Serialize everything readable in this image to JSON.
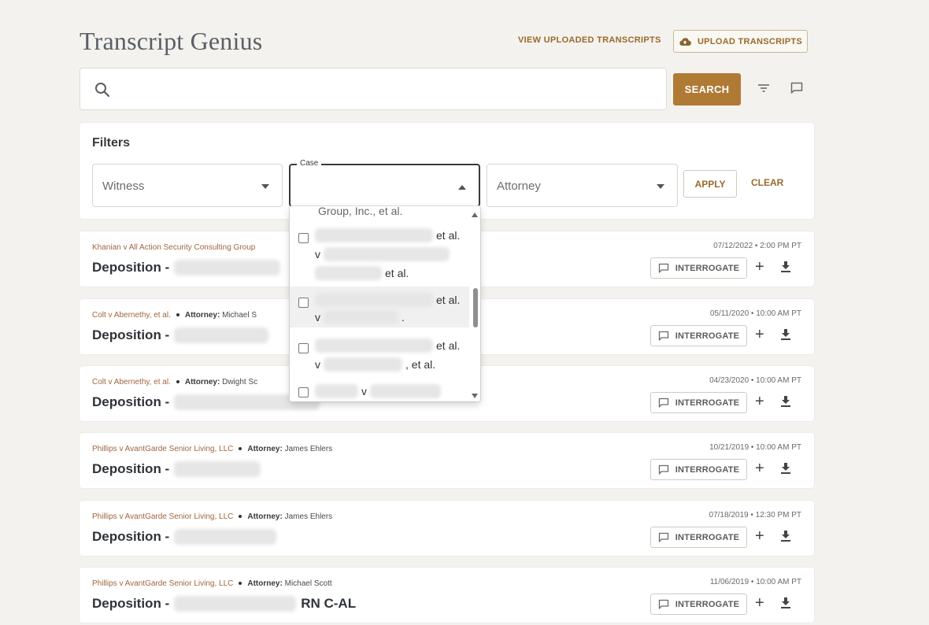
{
  "app": {
    "title": "Transcript Genius",
    "view_uploaded": "VIEW UPLOADED TRANSCRIPTS",
    "upload": "UPLOAD TRANSCRIPTS"
  },
  "search": {
    "value": "",
    "button": "SEARCH"
  },
  "filters": {
    "title": "Filters",
    "witness_placeholder": "Witness",
    "case_label": "Case",
    "attorney_placeholder": "Attorney",
    "apply": "APPLY",
    "clear": "CLEAR"
  },
  "dropdown": {
    "partial_top": "Group, Inc., et al.",
    "options": [
      {
        "l1_suffix": "et al.",
        "l2_prefix": "v",
        "l3_suffix": "et al."
      },
      {
        "l1_suffix": "et al.",
        "l2_prefix": "v",
        "l2_suffix": "."
      },
      {
        "l1_suffix": "et al.",
        "l2_prefix": "v",
        "l2_suffix": ", et al."
      },
      {
        "l1_mid": "v"
      }
    ]
  },
  "cards": [
    {
      "case": "Khanian v All Action Security Consulting Group",
      "attorney_label": "",
      "attorney": "",
      "title": "Deposition -",
      "title_suffix": "",
      "date": "07/12/2022 • 2:00 PM PT"
    },
    {
      "case": "Colt v Abernethy, et al.",
      "attorney_label": "Attorney:",
      "attorney": "Michael S",
      "title": "Deposition -",
      "title_suffix": "",
      "date": "05/11/2020 • 10:00 AM PT"
    },
    {
      "case": "Colt v Abernethy, et al.",
      "attorney_label": "Attorney:",
      "attorney": "Dwight Sc",
      "title": "Deposition -",
      "title_suffix": "",
      "date": "04/23/2020 • 10:00 AM PT"
    },
    {
      "case": "Phillips v AvantGarde Senior Living, LLC",
      "attorney_label": "Attorney:",
      "attorney": "James Ehlers",
      "title": "Deposition -",
      "title_suffix": "",
      "date": "10/21/2019 • 10:00 AM PT"
    },
    {
      "case": "Phillips v AvantGarde Senior Living, LLC",
      "attorney_label": "Attorney:",
      "attorney": "James Ehlers",
      "title": "Deposition -",
      "title_suffix": "",
      "date": "07/18/2019 • 12:30 PM PT"
    },
    {
      "case": "Phillips v AvantGarde Senior Living, LLC",
      "attorney_label": "Attorney:",
      "attorney": "Michael Scott",
      "title": "Deposition -",
      "title_suffix": "RN C-AL",
      "date": "11/06/2019 • 10:00 AM PT"
    }
  ],
  "card_actions": {
    "interrogate": "INTERROGATE",
    "plus": "+"
  }
}
